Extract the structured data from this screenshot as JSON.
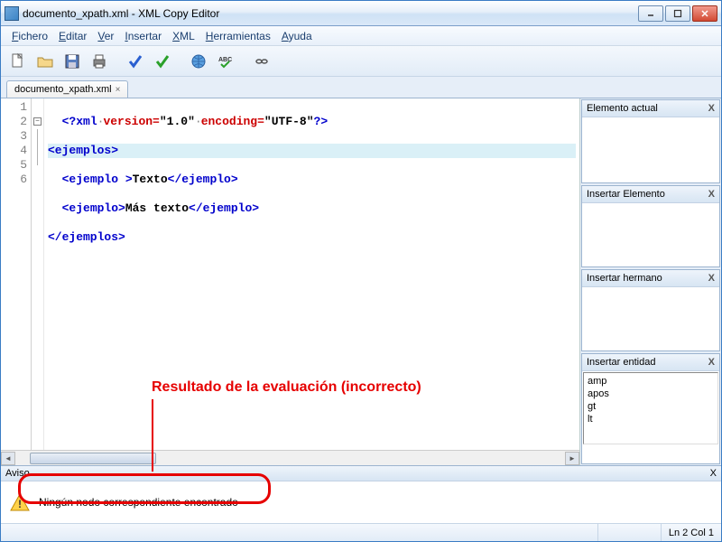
{
  "window": {
    "title": "documento_xpath.xml - XML Copy Editor"
  },
  "menu": {
    "fichero": "Fichero",
    "editar": "Editar",
    "ver": "Ver",
    "insertar": "Insertar",
    "xml": "XML",
    "herramientas": "Herramientas",
    "ayuda": "Ayuda"
  },
  "tabs": {
    "doc": "documento_xpath.xml"
  },
  "code": {
    "lines": [
      "1",
      "2",
      "3",
      "4",
      "5",
      "6"
    ]
  },
  "xml": {
    "pi_open": "<?",
    "pi_name": "xml",
    "attr_version": "version",
    "val_version": "\"1.0\"",
    "attr_encoding": "encoding",
    "val_encoding": "\"UTF-8\"",
    "pi_close": "?>",
    "root_open": "<ejemplos>",
    "root_close": "</ejemplos>",
    "ej_open_sp": "<ejemplo >",
    "ej_open": "<ejemplo>",
    "ej_close": "</ejemplo>",
    "txt1": "Texto",
    "txt2": "Más texto"
  },
  "side": {
    "elemento_actual": "Elemento actual",
    "insertar_elemento": "Insertar Elemento",
    "insertar_hermano": "Insertar hermano",
    "insertar_entidad": "Insertar entidad",
    "close_x": "X",
    "entities": [
      "amp",
      "apos",
      "gt",
      "lt"
    ]
  },
  "aviso": {
    "title": "Aviso",
    "message": "Ningún nodo correspondiente encontrado"
  },
  "status": {
    "pos": "Ln 2 Col 1"
  },
  "annotation": {
    "text": "Resultado de la evaluación (incorrecto)"
  }
}
